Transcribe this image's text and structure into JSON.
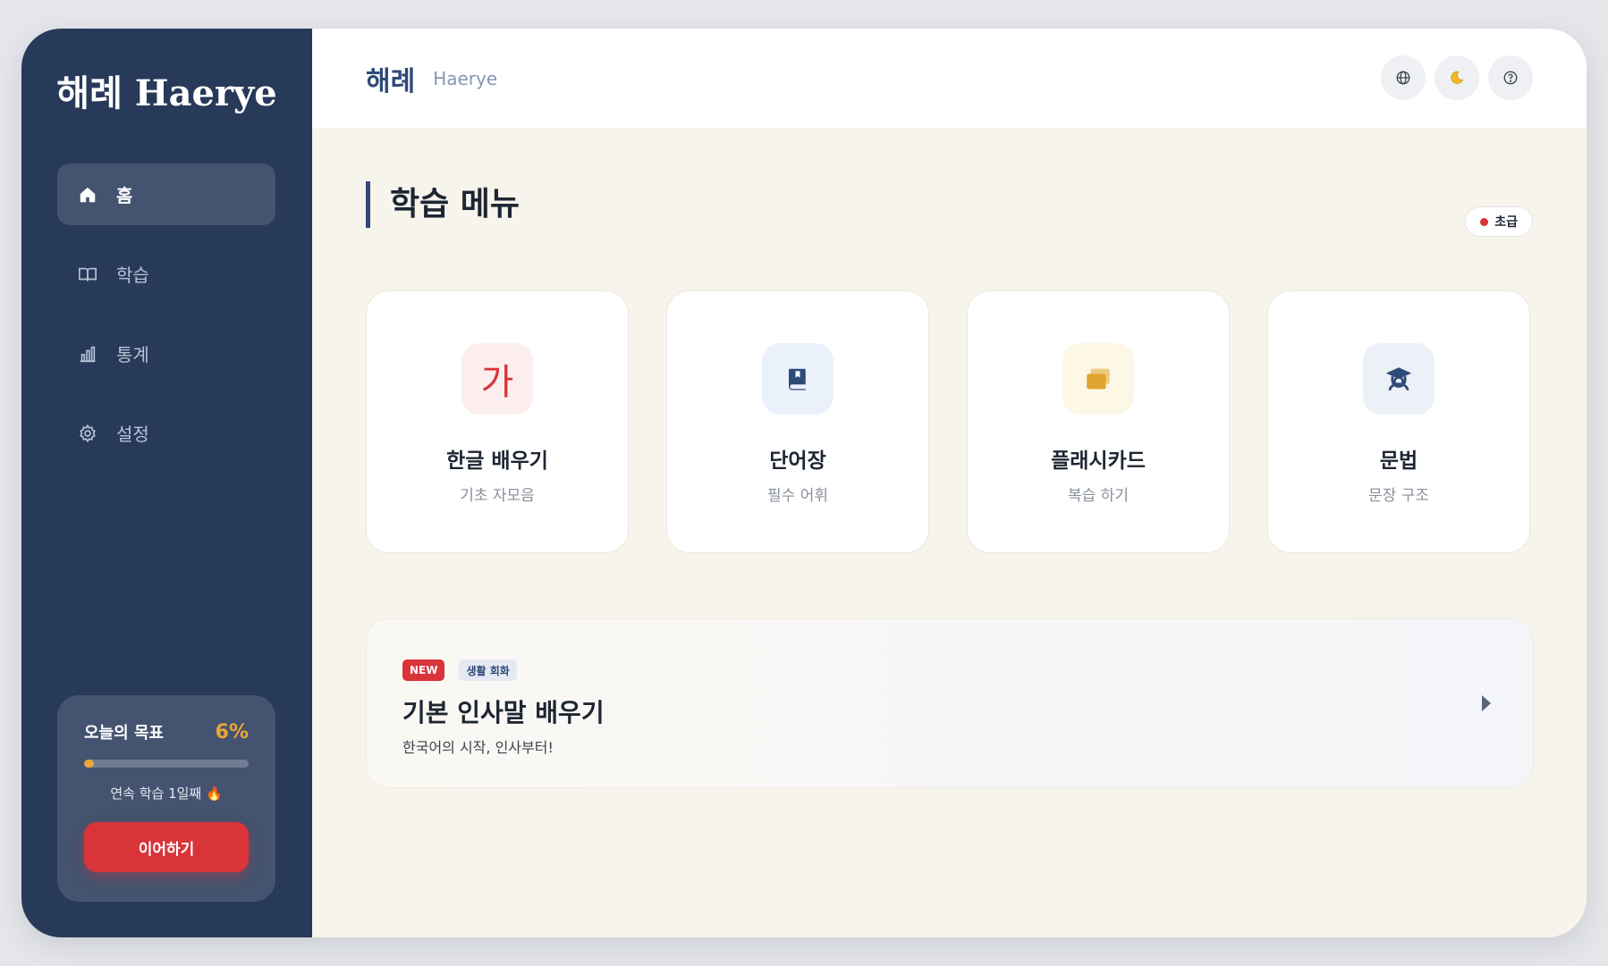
{
  "sidebar": {
    "brand": "해례 Haerye",
    "nav": [
      {
        "label": "홈",
        "icon": "home-icon",
        "active": true
      },
      {
        "label": "학습",
        "icon": "book-open-icon",
        "active": false
      },
      {
        "label": "통계",
        "icon": "bar-chart-icon",
        "active": false
      },
      {
        "label": "설정",
        "icon": "gear-icon",
        "active": false
      }
    ],
    "goal": {
      "title": "오늘의 목표",
      "percent_label": "6%",
      "progress": 0.06,
      "streak": "연속 학습 1일째 🔥",
      "continue_label": "이어하기"
    }
  },
  "header": {
    "title": "해례",
    "subtitle": "Haerye",
    "actions": [
      "globe-icon",
      "moon-icon",
      "help-icon"
    ]
  },
  "main": {
    "section_title": "학습 메뉴",
    "level": "초급",
    "cards": [
      {
        "title": "한글 배우기",
        "subtitle": "기초 자모음",
        "icon": "hangul-ga-icon",
        "icon_text": "가",
        "icon_bg": "#fdeeee",
        "icon_color": "#d9343a"
      },
      {
        "title": "단어장",
        "subtitle": "필수 어휘",
        "icon": "book-icon",
        "icon_bg": "#eaf1fb",
        "icon_color": "#2e4a78"
      },
      {
        "title": "플래시카드",
        "subtitle": "복습 하기",
        "icon": "cards-icon",
        "icon_bg": "#fdf8e6",
        "icon_color": "#e0a52e"
      },
      {
        "title": "문법",
        "subtitle": "문장 구조",
        "icon": "graduation-cap-icon",
        "icon_bg": "#ecf0f7",
        "icon_color": "#2e4a78"
      }
    ],
    "banner": {
      "tag_new": "NEW",
      "tag_topic": "생활 회화",
      "title": "기본 인사말 배우기",
      "description": "한국어의 시작, 인사부터!"
    }
  },
  "colors": {
    "sidebar_bg": "#283a5a",
    "accent_red": "#d9343a",
    "accent_gold": "#e8a73a",
    "navy": "#2e4a78"
  }
}
